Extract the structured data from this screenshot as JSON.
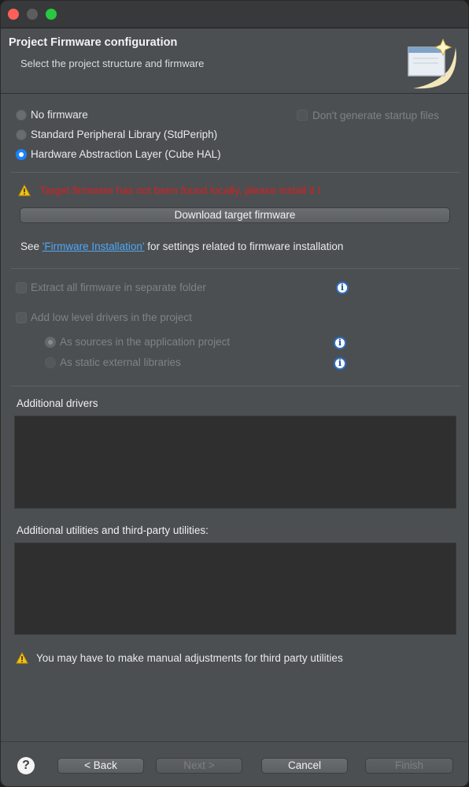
{
  "window": {
    "title": "Project Firmware configuration",
    "subtitle": "Select the project structure and firmware"
  },
  "firmware_options": {
    "no_firmware": "No firmware",
    "std_periph": "Standard Peripheral Library (StdPeriph)",
    "cube_hal": "Hardware Abstraction Layer (Cube HAL)",
    "selected": "cube_hal",
    "dont_generate_startup": "Don't generate startup files"
  },
  "warning": {
    "message": "Target firmware has not been found locally, please install it !"
  },
  "download_button": "Download target firmware",
  "installation_note": {
    "prefix": "See ",
    "link": "'Firmware Installation'",
    "suffix": " for settings related to firmware installation"
  },
  "options": {
    "extract_separate": "Extract all firmware in separate folder",
    "add_ll_drivers": "Add low level drivers in the project",
    "as_sources": "As sources in the application project",
    "as_static_libs": "As static external libraries"
  },
  "additional_drivers": {
    "label": "Additional drivers"
  },
  "additional_utilities": {
    "label": "Additional utilities and third-party utilities:"
  },
  "bottom_warning": "You may have to make manual adjustments for third party utilities",
  "footer": {
    "help": "?",
    "back": "< Back",
    "next": "Next >",
    "cancel": "Cancel",
    "finish": "Finish"
  },
  "icons": {
    "warning": "warning-triangle-icon",
    "info": "info-icon",
    "help": "help-icon",
    "wizard": "wizard-banner-icon"
  },
  "colors": {
    "accent": "#1a82ff",
    "warning_text": "#d42020",
    "link": "#4fa8f5"
  }
}
